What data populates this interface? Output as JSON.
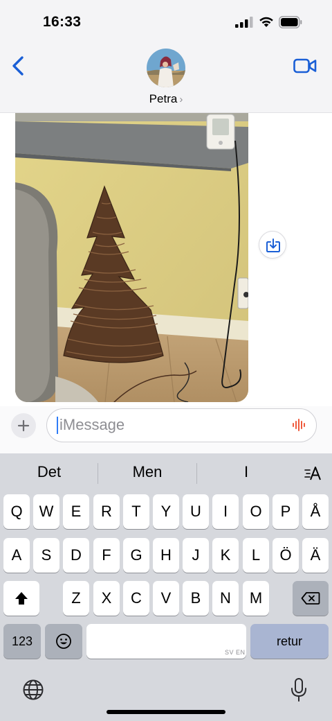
{
  "status_bar": {
    "time": "16:33",
    "icons": [
      "cellular-signal-icon",
      "wifi-icon",
      "battery-icon"
    ]
  },
  "header": {
    "back_icon": "chevron-left-icon",
    "contact_name": "Petra",
    "contact_chevron": "›",
    "video_icon": "video-camera-icon",
    "accent_color": "#1a5fd6"
  },
  "thread": {
    "message_photo": "photo of a woven brown cone-shaped Christmas tree decoration against a yellow wall",
    "save_icon": "save-download-icon"
  },
  "input": {
    "add_icon": "plus-icon",
    "placeholder": "iMessage",
    "audio_icon": "audio-waveform-icon"
  },
  "keyboard": {
    "predictions": [
      "Det",
      "Men",
      "I"
    ],
    "text_format_icon": "text-format-icon",
    "row1": [
      "Q",
      "W",
      "E",
      "R",
      "T",
      "Y",
      "U",
      "I",
      "O",
      "P",
      "Å"
    ],
    "row2": [
      "A",
      "S",
      "D",
      "F",
      "G",
      "H",
      "J",
      "K",
      "L",
      "Ö",
      "Ä"
    ],
    "row3": [
      "Z",
      "X",
      "C",
      "V",
      "B",
      "N",
      "M"
    ],
    "shift_icon": "shift-icon",
    "delete_icon": "backspace-icon",
    "numbers_label": "123",
    "emoji_icon": "emoji-icon",
    "space_language": "SV EN",
    "return_label": "retur",
    "globe_icon": "globe-icon",
    "mic_icon": "microphone-icon"
  }
}
